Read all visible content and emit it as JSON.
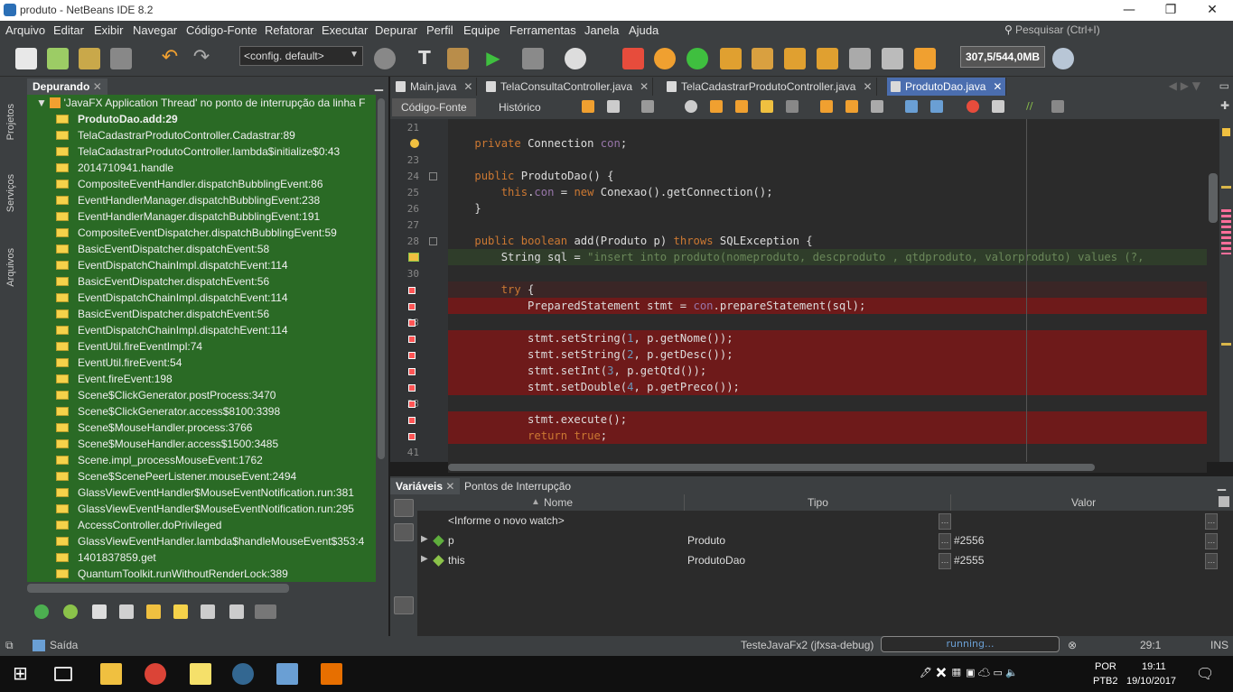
{
  "window": {
    "title": "produto - NetBeans IDE 8.2",
    "min": "—",
    "max": "❐",
    "close": "✕"
  },
  "menu": [
    "Arquivo",
    "Editar",
    "Exibir",
    "Navegar",
    "Código-Fonte",
    "Refatorar",
    "Executar",
    "Depurar",
    "Perfil",
    "Equipe",
    "Ferramentas",
    "Janela",
    "Ajuda"
  ],
  "search_placeholder": "Pesquisar (Ctrl+I)",
  "toolbar": {
    "config": "<config. default>",
    "memory": "307,5/544,0MB"
  },
  "side_tabs": {
    "projects": "Projetos",
    "services": "Serviços",
    "files": "Arquivos"
  },
  "debug_panel": {
    "tab_label": "Depurando",
    "thread": "'JavaFX Application Thread' no ponto de interrupção da linha F",
    "frames": [
      "ProdutoDao.add:29",
      "TelaCadastrarProdutoController.Cadastrar:89",
      "TelaCadastrarProdutoController.lambda$initialize$0:43",
      "2014710941.handle",
      "CompositeEventHandler.dispatchBubblingEvent:86",
      "EventHandlerManager.dispatchBubblingEvent:238",
      "EventHandlerManager.dispatchBubblingEvent:191",
      "CompositeEventDispatcher.dispatchBubblingEvent:59",
      "BasicEventDispatcher.dispatchEvent:58",
      "EventDispatchChainImpl.dispatchEvent:114",
      "BasicEventDispatcher.dispatchEvent:56",
      "EventDispatchChainImpl.dispatchEvent:114",
      "BasicEventDispatcher.dispatchEvent:56",
      "EventDispatchChainImpl.dispatchEvent:114",
      "EventUtil.fireEventImpl:74",
      "EventUtil.fireEvent:54",
      "Event.fireEvent:198",
      "Scene$ClickGenerator.postProcess:3470",
      "Scene$ClickGenerator.access$8100:3398",
      "Scene$MouseHandler.process:3766",
      "Scene$MouseHandler.access$1500:3485",
      "Scene.impl_processMouseEvent:1762",
      "Scene$ScenePeerListener.mouseEvent:2494",
      "GlassViewEventHandler$MouseEventNotification.run:381",
      "GlassViewEventHandler$MouseEventNotification.run:295",
      "AccessController.doPrivileged",
      "GlassViewEventHandler.lambda$handleMouseEvent$353:4",
      "1401837859.get",
      "QuantumToolkit.runWithoutRenderLock:389"
    ]
  },
  "editor": {
    "tabs": [
      "Main.java",
      "TelaConsultaController.java",
      "TelaCadastrarProdutoController.java",
      "ProdutoDao.java"
    ],
    "active_tab": 3,
    "source_btn": "Código-Fonte",
    "history_btn": "Histórico",
    "line_numbers": [
      "21",
      "",
      "23",
      "24",
      "25",
      "26",
      "27",
      "28",
      "",
      "30",
      "",
      "",
      "33",
      "",
      "",
      "",
      "",
      "38",
      "",
      "",
      "41"
    ],
    "code": [
      "",
      "    private Connection con;",
      "",
      "    public ProdutoDao() {",
      "        this.con = new Conexao().getConnection();",
      "    }",
      "",
      "    public boolean add(Produto p) throws SQLException {",
      "        String sql = \"insert into produto(nomeproduto, descproduto , qtdproduto, valorproduto) values (?,",
      "",
      "        try {",
      "            PreparedStatement stmt = con.prepareStatement(sql);",
      "",
      "            stmt.setString(1, p.getNome());",
      "            stmt.setString(2, p.getDesc());",
      "            stmt.setInt(3, p.getQtd());",
      "            stmt.setDouble(4, p.getPreco());",
      "",
      "            stmt.execute();",
      "            return true;",
      ""
    ]
  },
  "variables": {
    "tabs": [
      "Variáveis",
      "Pontos de Interrupção"
    ],
    "headers": {
      "name": "Nome",
      "type": "Tipo",
      "value": "Valor"
    },
    "watch_placeholder": "<Informe o novo watch>",
    "rows": [
      {
        "name": "p",
        "type": "Produto",
        "value": "#2556"
      },
      {
        "name": "this",
        "type": "ProdutoDao",
        "value": "#2555"
      }
    ]
  },
  "statusbar": {
    "output": "Saída",
    "session": "TesteJavaFx2 (jfxsa-debug)",
    "progress": "running...",
    "position": "29:1",
    "mode": "INS"
  },
  "taskbar": {
    "lang": "POR",
    "layout": "PTB2",
    "time": "19:11",
    "date": "19/10/2017"
  }
}
